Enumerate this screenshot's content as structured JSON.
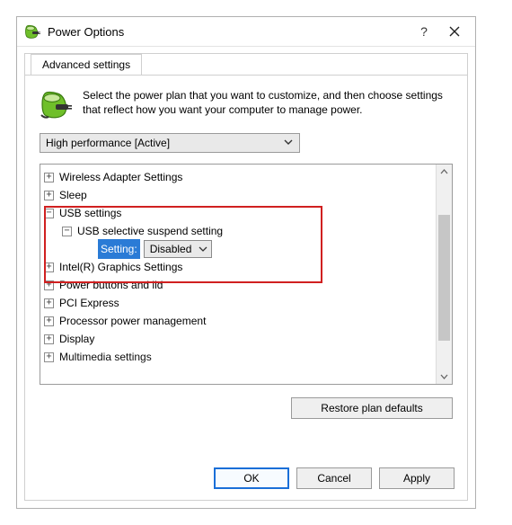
{
  "window": {
    "title": "Power Options"
  },
  "tab": {
    "label": "Advanced settings"
  },
  "intro": {
    "text": "Select the power plan that you want to customize, and then choose settings that reflect how you want your computer to manage power."
  },
  "plan_select": {
    "value": "High performance [Active]"
  },
  "tree": {
    "wireless": {
      "label": "Wireless Adapter Settings"
    },
    "sleep": {
      "label": "Sleep"
    },
    "usb": {
      "label": "USB settings",
      "child": {
        "label": "USB selective suspend setting",
        "setting_label": "Setting:",
        "setting_value": "Disabled"
      }
    },
    "graphics": {
      "label": "Intel(R) Graphics Settings"
    },
    "power_buttons": {
      "label": "Power buttons and lid"
    },
    "pci": {
      "label": "PCI Express"
    },
    "ppm": {
      "label": "Processor power management"
    },
    "display": {
      "label": "Display"
    },
    "multimedia": {
      "label": "Multimedia settings"
    }
  },
  "buttons": {
    "restore": "Restore plan defaults",
    "ok": "OK",
    "cancel": "Cancel",
    "apply": "Apply"
  }
}
